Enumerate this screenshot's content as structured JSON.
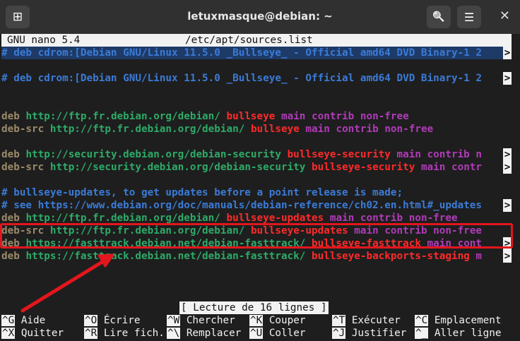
{
  "window": {
    "title": "letuxmasque@debian: ~",
    "new_tab_icon": "new-tab-icon",
    "search_icon": "search-icon",
    "menu_icon": "hamburger-menu-icon",
    "close_icon": "close-icon",
    "new_tab_glyph": "⊞",
    "search_glyph": "🔍",
    "menu_glyph": "☰",
    "close_glyph": "✕"
  },
  "nano": {
    "version": "GNU nano 5.4",
    "filename": "/etc/apt/sources.list",
    "status_message": "[ Lecture de 16 lignes ]",
    "more_marker": ">"
  },
  "lines": [
    {
      "comment": "# deb cdrom:[Debian GNU/Linux 11.5.0 _Bullseye_ - Official amd64 DVD Binary-1 2"
    },
    {
      "empty": ""
    },
    {
      "comment": "# deb cdrom:[Debian GNU/Linux 11.5.0 _Bullseye_ - Official amd64 DVD Binary-1 2"
    },
    {
      "empty": ""
    },
    {
      "empty": ""
    },
    {
      "type": "deb",
      "url": "http://ftp.fr.debian.org/debian/",
      "suite": "bullseye",
      "components": "main contrib non-free"
    },
    {
      "type": "deb-src",
      "url": "http://ftp.fr.debian.org/debian/",
      "suite": "bullseye",
      "components": "main contrib non-free"
    },
    {
      "empty": ""
    },
    {
      "type": "deb",
      "url": "http://security.debian.org/debian-security",
      "suite": "bullseye-security",
      "components": "main contrib n"
    },
    {
      "type": "deb-src",
      "url": "http://security.debian.org/debian-security",
      "suite": "bullseye-security",
      "components": "main contr"
    },
    {
      "empty": ""
    },
    {
      "comment": "# bullseye-updates, to get updates before a point release is made;"
    },
    {
      "comment": "# see https://www.debian.org/doc/manuals/debian-reference/ch02.en.html#_updates"
    },
    {
      "type": "deb",
      "url": "http://ftp.fr.debian.org/debian/",
      "suite": "bullseye-updates",
      "components": "main contrib non-free"
    },
    {
      "type": "deb-src",
      "url": "http://ftp.fr.debian.org/debian/",
      "suite": "bullseye-updates",
      "components": "main contrib non-free"
    },
    {
      "type": "deb",
      "url": "https://fasttrack.debian.net/debian-fasttrack/",
      "suite": "bullseye-fasttrack",
      "components": "main cont"
    },
    {
      "type": "deb",
      "url": "https://fasttrack.debian.net/debian-fasttrack/",
      "suite": "bullseye-backports-staging",
      "components": "m"
    }
  ],
  "shortcuts": [
    {
      "key": "^G",
      "label": "Aide"
    },
    {
      "key": "^O",
      "label": "Écrire"
    },
    {
      "key": "^W",
      "label": "Chercher"
    },
    {
      "key": "^K",
      "label": "Couper"
    },
    {
      "key": "^T",
      "label": "Exécuter"
    },
    {
      "key": "^C",
      "label": "Emplacement"
    },
    {
      "key": "^X",
      "label": "Quitter"
    },
    {
      "key": "^R",
      "label": "Lire fich."
    },
    {
      "key": "^\\",
      "label": "Remplacer"
    },
    {
      "key": "^U",
      "label": "Coller"
    },
    {
      "key": "^J",
      "label": "Justifier"
    },
    {
      "key": "^_",
      "label": "Aller ligne"
    }
  ],
  "colors": {
    "annotation_red": "#e3161c",
    "comment_blue": "#3b7bd7",
    "url_green": "#2eaa68",
    "suite_red": "#ff2a2a",
    "component_purple": "#b03bb8"
  }
}
